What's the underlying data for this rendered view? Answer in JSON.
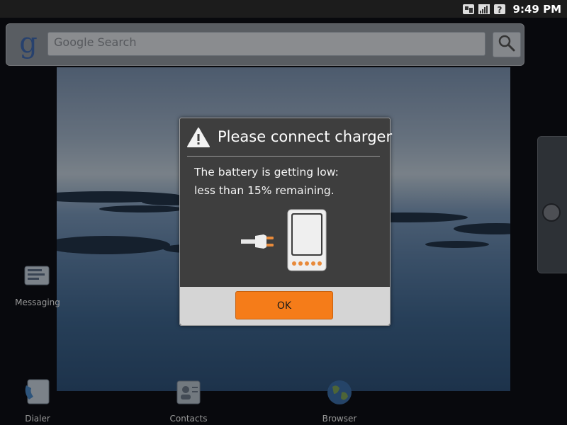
{
  "status_bar": {
    "time": "9:49 PM",
    "icons": [
      "sim-icon",
      "signal-icon",
      "battery-low-icon"
    ]
  },
  "search": {
    "placeholder": "Google Search",
    "logo_letter": "g"
  },
  "shortcuts": {
    "messaging": "Messaging",
    "dialer": "Dialer",
    "contacts": "Contacts",
    "browser": "Browser"
  },
  "dialog": {
    "title": "Please connect charger",
    "message_line1": "The battery is getting low:",
    "message_line2": "less than 15% remaining.",
    "ok_label": "OK",
    "icon": "warning-icon"
  },
  "colors": {
    "accent": "#f57c19",
    "dialog_bg": "#3e3e3e",
    "footer_bg": "#d5d5d5"
  }
}
